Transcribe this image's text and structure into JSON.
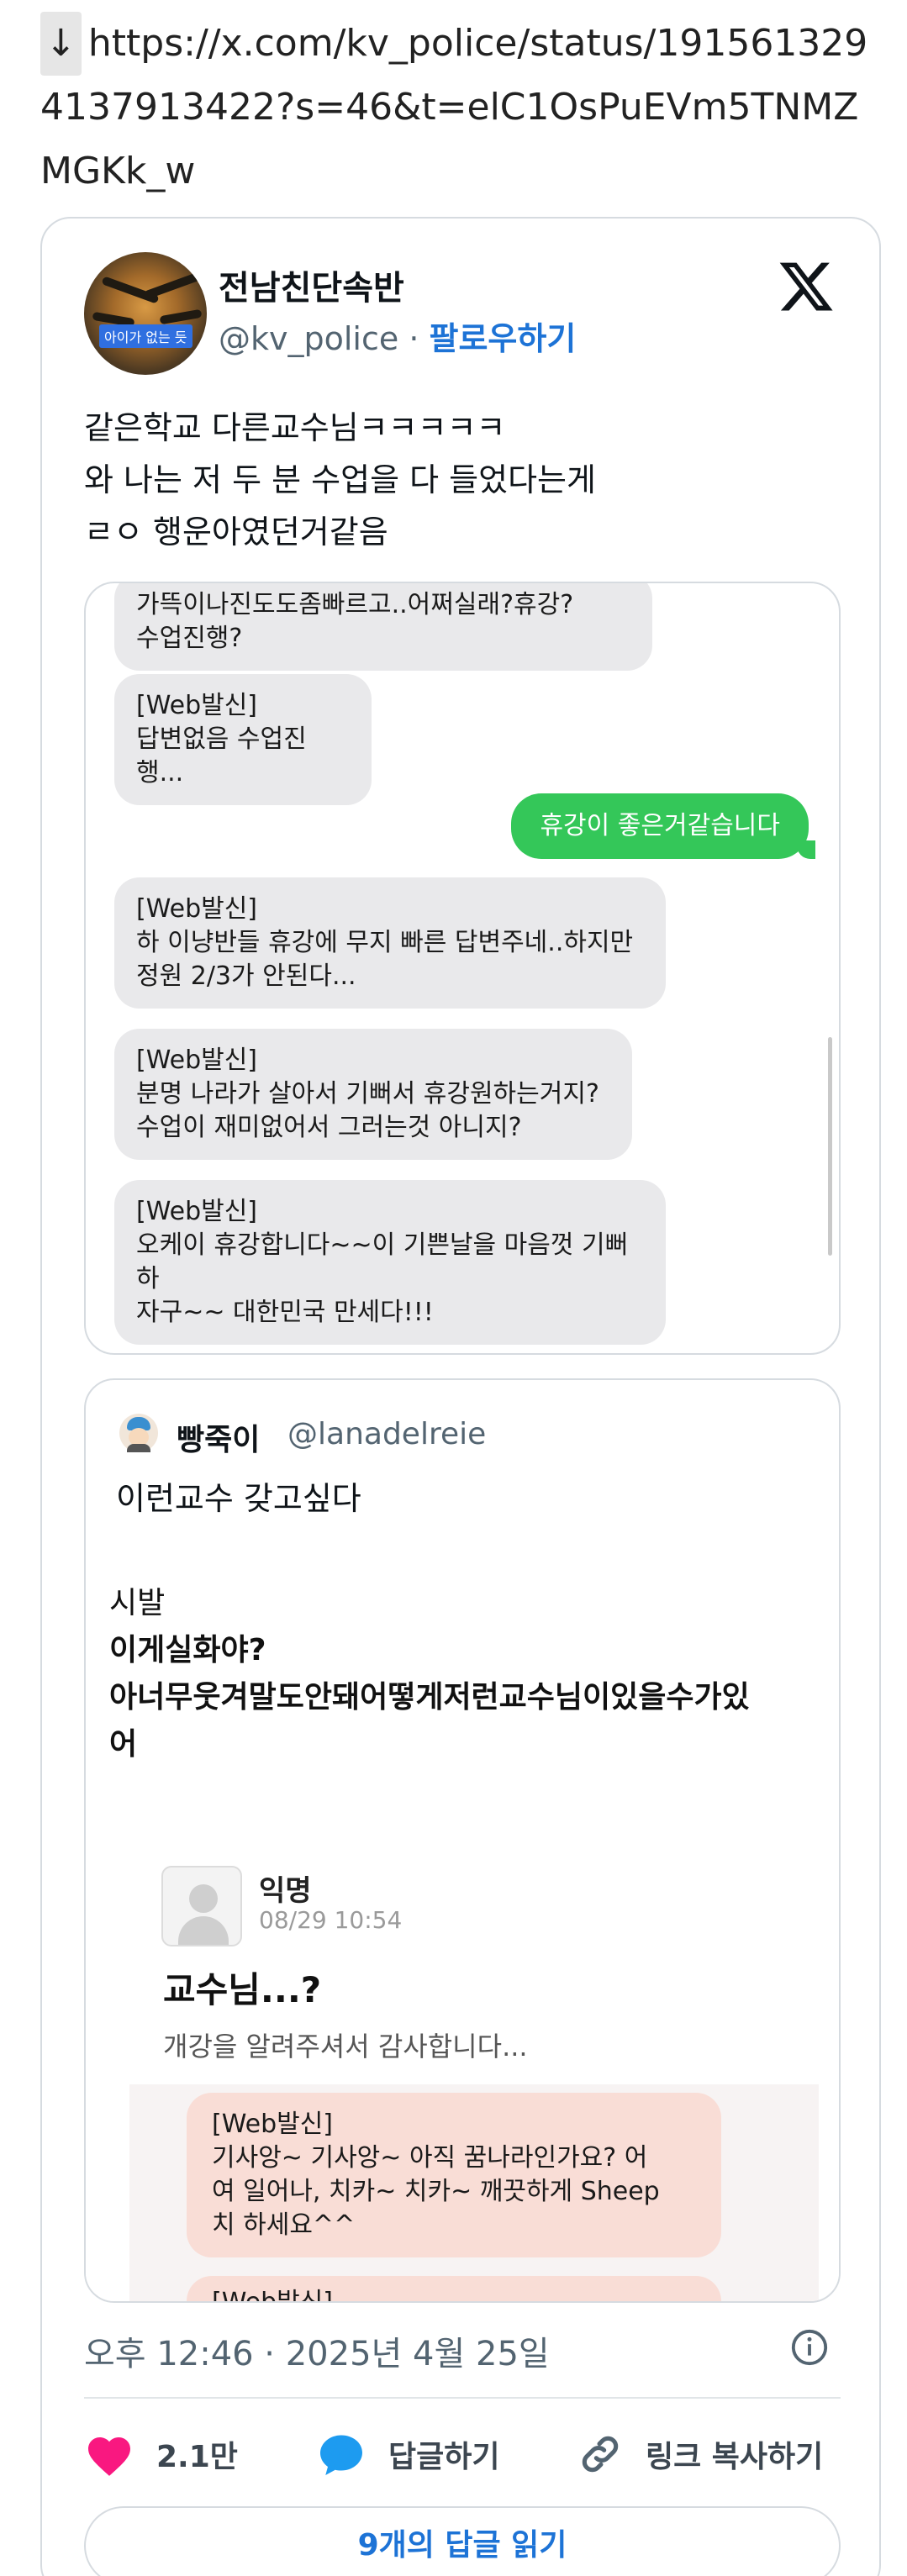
{
  "url": {
    "arrow": "↓",
    "text": "https://x.com/kv_police/status/1915613294137913422?s=46&t=elC1OsPuEVm5TNMZMGKk_w"
  },
  "tweet": {
    "display_name": "전남친단속반",
    "handle": "@kv_police",
    "separator": " · ",
    "follow_label": "팔로우하기",
    "avatar_caption": "아이가 없는 듯",
    "text_lines": [
      "같은학교 다른교수님ㅋㅋㅋㅋㅋ",
      "와 나는 저 두 분 수업을 다 들었다는게",
      "ㄹㅇ 행운아였던거같음"
    ],
    "chat": {
      "partial_top": "가뜩이나진도도좀빠르고..어쩌실래?휴강?\n수업진행?",
      "messages": [
        {
          "text": "[Web발신]\n답변없음 수업진행..."
        },
        {
          "text": "휴강이 좋은거같습니다",
          "sent": true
        },
        {
          "text": "[Web발신]\n하 이냥반들 휴강에 무지 빠른 답변주네..하지만\n정원 2/3가 안된다..."
        },
        {
          "text": "[Web발신]\n분명 나라가 살아서 기뻐서 휴강원하는거지?\n수업이 재미없어서 그러는것 아니지?"
        },
        {
          "text": "[Web발신]\n오케이 휴강합니다~~이 기쁜날을 마음껏 기뻐하\n자구~~ 대한민국 만세다!!!"
        }
      ]
    },
    "quote": {
      "display_name": "빵죽이",
      "handle": "@lanadelreie",
      "line1": "이런교수 갖고싶다",
      "body": [
        "시발",
        "이게실화야?",
        "아너무웃겨말도안돼어떻게저런교수님이있을수가있",
        "어"
      ],
      "post": {
        "author": "익명",
        "date": "08/29 10:54",
        "title": "교수님...?",
        "subtitle": "개강을 알려주셔서 감사합니다...",
        "bubble1": "[Web발신]\n기사앙~ 기사앙~ 아직 꿈나라인가요? 어\n여 일어나, 치카~ 치카~ 깨끗하게 Sheep\n치 하세요^^",
        "bubble2_partial": "[Web발신]"
      }
    },
    "timestamp": "오후 12:46 · 2025년 4월 25일",
    "actions": {
      "likes": "2.1만",
      "reply": "답글하기",
      "copy_link": "링크 복사하기"
    },
    "read_replies": "9개의 답글 읽기"
  },
  "colors": {
    "link_blue": "#1d73d6",
    "sent_bubble_green": "#34c759",
    "like_pink": "#f91880",
    "reply_blue": "#1d9bf0"
  }
}
